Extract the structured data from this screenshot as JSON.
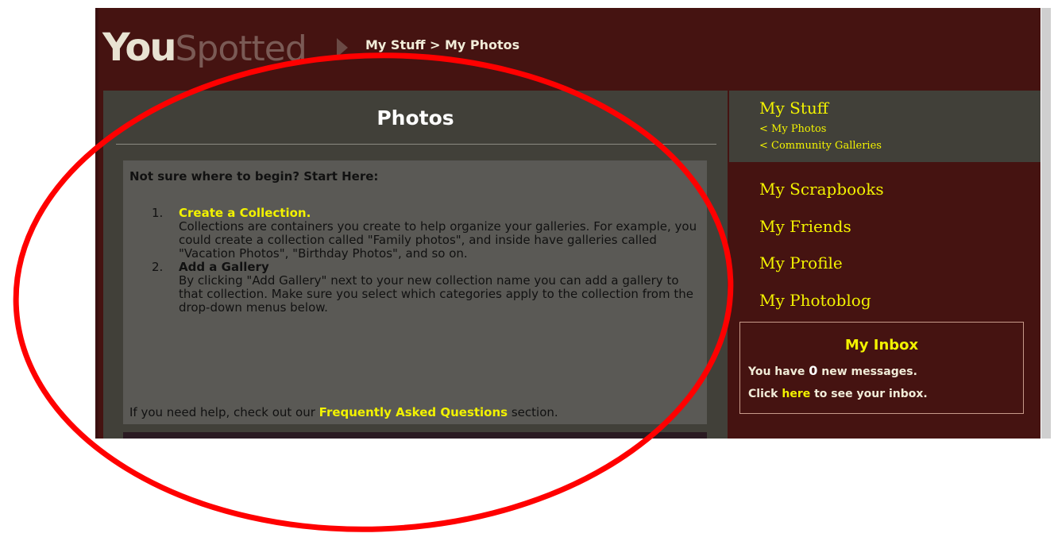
{
  "logo": {
    "you": "You",
    "spotted": "Spotted"
  },
  "breadcrumb": {
    "text": "My Stuff > My Photos"
  },
  "main": {
    "title": "Photos",
    "heading": "Not sure where to begin? Start Here:",
    "steps": [
      {
        "num": "1.",
        "title": "Create a Collection.",
        "body": "Collections are containers you create to help organize your galleries. For example, you could create a collection called \"Family photos\", and inside have galleries called \"Vacation Photos\", \"Birthday Photos\", and so on."
      },
      {
        "num": "2.",
        "title": "Add a Gallery",
        "body": "By clicking \"Add Gallery\" next to your new collection name you can add a gallery to that collection. Make sure you select which categories apply to the collection from the drop-down menus below."
      }
    ],
    "help_prefix": "If you need help, check out our ",
    "help_link": "Frequently Asked Questions",
    "help_suffix": " section."
  },
  "sidebar": {
    "my_stuff": "My Stuff",
    "sub_links": [
      "< My Photos",
      "< Community Galleries"
    ],
    "links": [
      "My Scrapbooks",
      "My Friends",
      "My Profile",
      "My Photoblog"
    ],
    "inbox": {
      "title": "My Inbox",
      "line1_prefix": "You have ",
      "count": "0",
      "line1_suffix": " new messages.",
      "line2_prefix": "Click ",
      "line2_link": "here",
      "line2_suffix": " to see your inbox."
    }
  },
  "colors": {
    "page_bg": "#451311",
    "panel_bg": "#414039",
    "box_bg": "#5a5955",
    "accent_yellow": "#f2f200",
    "annotation_red": "#ff0000"
  }
}
